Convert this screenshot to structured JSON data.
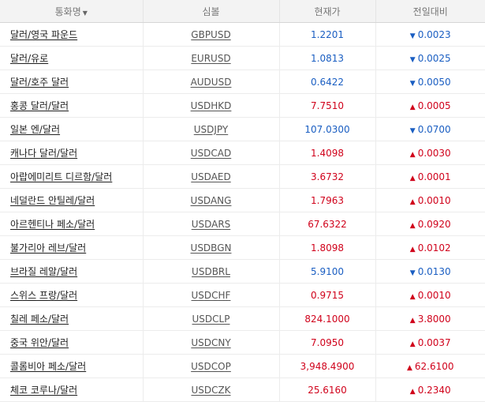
{
  "header": {
    "name": "통화명",
    "sort_icon": "▼",
    "symbol": "심볼",
    "price": "현재가",
    "change": "전일대비"
  },
  "colors": {
    "up": "#d0021b",
    "down": "#1a5ec2"
  },
  "rows": [
    {
      "name": "달러/영국 파운드",
      "symbol": "GBPUSD",
      "price": "1.2201",
      "dir": "down",
      "arrow": "▼",
      "change": "0.0023"
    },
    {
      "name": "달러/유로",
      "symbol": "EURUSD",
      "price": "1.0813",
      "dir": "down",
      "arrow": "▼",
      "change": "0.0025"
    },
    {
      "name": "달러/호주 달러",
      "symbol": "AUDUSD",
      "price": "0.6422",
      "dir": "down",
      "arrow": "▼",
      "change": "0.0050"
    },
    {
      "name": "홍콩 달러/달러",
      "symbol": "USDHKD",
      "price": "7.7510",
      "dir": "up",
      "arrow": "▲",
      "change": "0.0005"
    },
    {
      "name": "일본 엔/달러",
      "symbol": "USDJPY",
      "price": "107.0300",
      "dir": "down",
      "arrow": "▼",
      "change": "0.0700"
    },
    {
      "name": "캐나다 달러/달러",
      "symbol": "USDCAD",
      "price": "1.4098",
      "dir": "up",
      "arrow": "▲",
      "change": "0.0030"
    },
    {
      "name": "아랍에미리트 디르함/달러",
      "symbol": "USDAED",
      "price": "3.6732",
      "dir": "up",
      "arrow": "▲",
      "change": "0.0001"
    },
    {
      "name": "네덜란드 안틸레/달러",
      "symbol": "USDANG",
      "price": "1.7963",
      "dir": "up",
      "arrow": "▲",
      "change": "0.0010"
    },
    {
      "name": "아르헨티나 페소/달러",
      "symbol": "USDARS",
      "price": "67.6322",
      "dir": "up",
      "arrow": "▲",
      "change": "0.0920"
    },
    {
      "name": "불가리아 레브/달러",
      "symbol": "USDBGN",
      "price": "1.8098",
      "dir": "up",
      "arrow": "▲",
      "change": "0.0102"
    },
    {
      "name": "브라질 레알/달러",
      "symbol": "USDBRL",
      "price": "5.9100",
      "dir": "down",
      "arrow": "▼",
      "change": "0.0130"
    },
    {
      "name": "스위스 프랑/달러",
      "symbol": "USDCHF",
      "price": "0.9715",
      "dir": "up",
      "arrow": "▲",
      "change": "0.0010"
    },
    {
      "name": "칠레 페소/달러",
      "symbol": "USDCLP",
      "price": "824.1000",
      "dir": "up",
      "arrow": "▲",
      "change": "3.8000"
    },
    {
      "name": "중국 위안/달러",
      "symbol": "USDCNY",
      "price": "7.0950",
      "dir": "up",
      "arrow": "▲",
      "change": "0.0037"
    },
    {
      "name": "콜롬비아 페소/달러",
      "symbol": "USDCOP",
      "price": "3,948.4900",
      "dir": "up",
      "arrow": "▲",
      "change": "62.6100"
    },
    {
      "name": "체코 코루나/달러",
      "symbol": "USDCZK",
      "price": "25.6160",
      "dir": "up",
      "arrow": "▲",
      "change": "0.2340"
    }
  ]
}
